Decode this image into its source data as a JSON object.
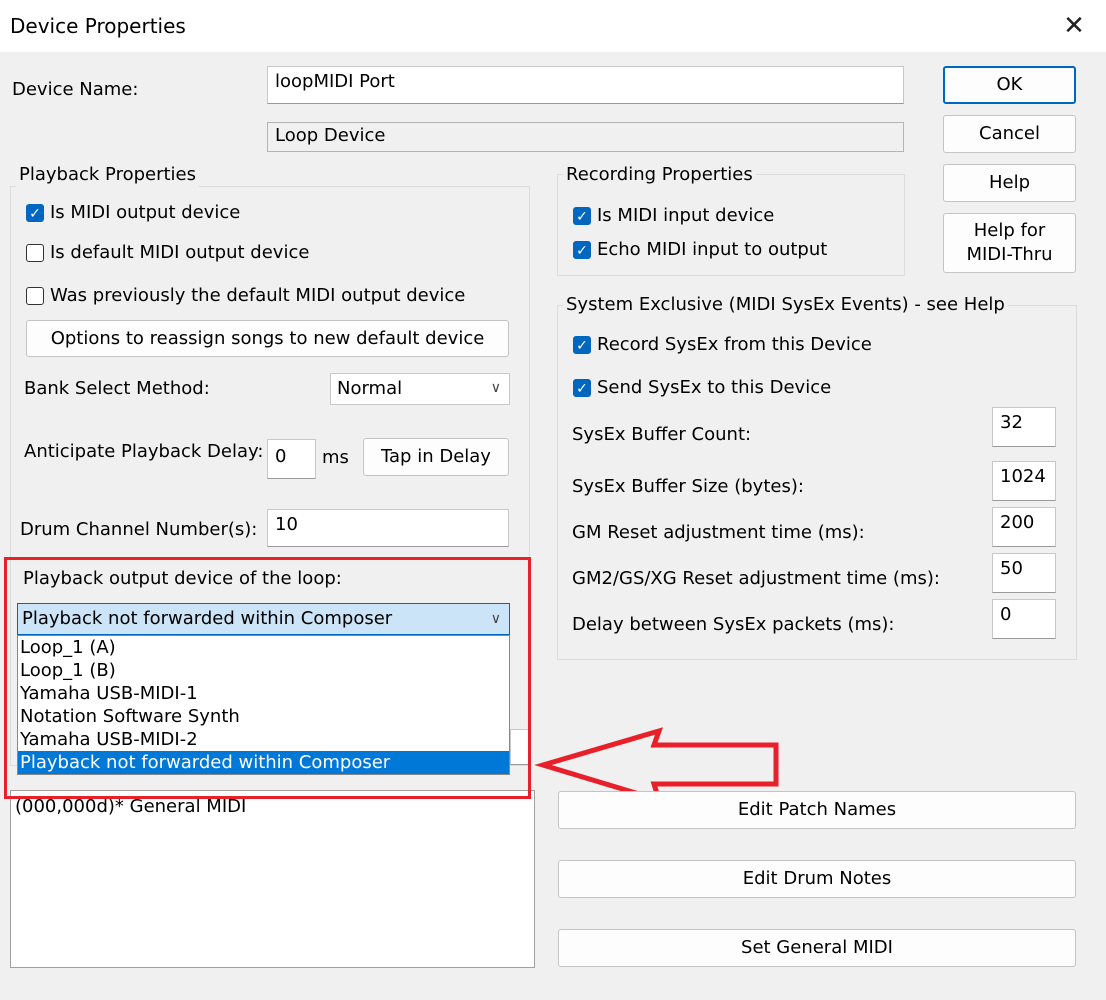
{
  "window": {
    "title": "Device Properties"
  },
  "device": {
    "name_label": "Device Name:",
    "name_value": "loopMIDI Port",
    "type_value": "Loop Device"
  },
  "buttons": {
    "ok": "OK",
    "cancel": "Cancel",
    "help": "Help",
    "help_thru_1": "Help for",
    "help_thru_2": "MIDI-Thru"
  },
  "playback": {
    "title": "Playback Properties",
    "is_output": {
      "label": "Is MIDI output device",
      "checked": true
    },
    "is_default": {
      "label": "Is default MIDI output device",
      "checked": false
    },
    "was_default": {
      "label": "Was previously the default MIDI output device",
      "checked": false
    },
    "reassign_button": "Options to reassign songs to new default device",
    "bank_label": "Bank Select Method:",
    "bank_value": "Normal",
    "anticipate_label": "Anticipate Playback Delay:",
    "anticipate_value": "0",
    "ms_label": "ms",
    "tap_button": "Tap in Delay",
    "drum_label": "Drum Channel Number(s):",
    "drum_value": "10",
    "loop_output_label": "Playback output device of the loop:",
    "loop_output_selected": "Playback not forwarded within Composer",
    "loop_output_options": [
      "Loop_1 (A)",
      "Loop_1 (B)",
      "Yamaha USB-MIDI-1",
      "Notation Software Synth",
      "Yamaha USB-MIDI-2",
      "Playback not forwarded within Composer"
    ],
    "patch_list": [
      "(000,000d)* General MIDI"
    ]
  },
  "recording": {
    "title": "Recording Properties",
    "is_input": {
      "label": "Is MIDI input device",
      "checked": true
    },
    "echo": {
      "label": "Echo MIDI input to output",
      "checked": true
    }
  },
  "sysex": {
    "title": "System Exclusive (MIDI SysEx Events)  -  see Help",
    "record": {
      "label": "Record SysEx from this Device",
      "checked": true
    },
    "send": {
      "label": "Send SysEx to this Device",
      "checked": true
    },
    "buffer_count_label": "SysEx Buffer Count:",
    "buffer_count_value": "32",
    "buffer_size_label": "SysEx Buffer Size (bytes):",
    "buffer_size_value": "1024",
    "gm_reset_label": "GM Reset adjustment time (ms):",
    "gm_reset_value": "200",
    "gm2_reset_label": "GM2/GS/XG Reset adjustment time (ms):",
    "gm2_reset_value": "50",
    "delay_label": "Delay between SysEx packets (ms):",
    "delay_value": "0"
  },
  "patch_buttons": {
    "edit_patch": "Edit Patch Names",
    "edit_drum": "Edit Drum Notes",
    "set_gm": "Set General MIDI"
  },
  "colors": {
    "accent": "#0067c0",
    "annotation": "#e8202a",
    "selection": "#0078d7"
  }
}
